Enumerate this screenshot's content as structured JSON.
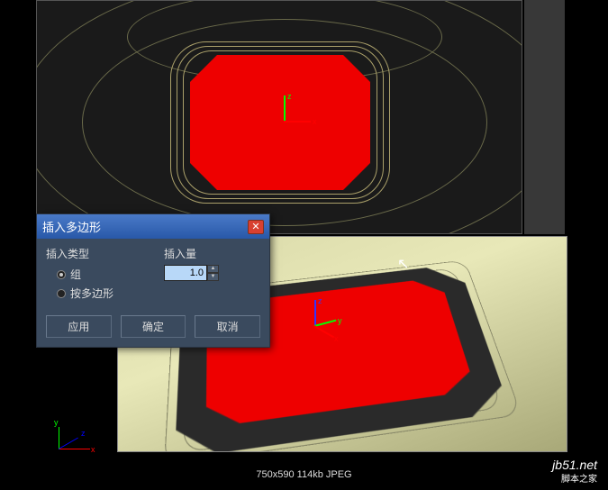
{
  "dialog": {
    "title": "插入多边形",
    "insert_type_label": "插入类型",
    "radio_group": "组",
    "radio_by_poly": "按多边形",
    "amount_label": "插入量",
    "amount_value": "1.0",
    "apply_label": "应用",
    "ok_label": "确定",
    "cancel_label": "取消"
  },
  "axes": {
    "x": "x",
    "y": "y",
    "z": "z"
  },
  "status": {
    "dimensions": "750x590",
    "filesize": "114kb",
    "format": "JPEG"
  },
  "watermark": {
    "site": "jb51.net",
    "name": "脚本之家"
  }
}
